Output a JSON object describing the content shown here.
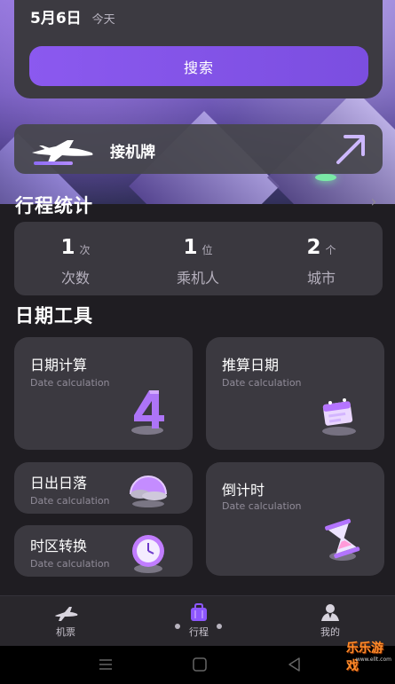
{
  "hero": {
    "date": "5月6日",
    "date_sub": "今天",
    "search_label": "搜索"
  },
  "pickup": {
    "title": "接机牌",
    "plane_icon": "airplane-icon",
    "arrow_icon": "arrow-up-right-icon"
  },
  "stats": {
    "title": "行程统计",
    "items": [
      {
        "value": "1",
        "unit": "次",
        "label": "次数"
      },
      {
        "value": "1",
        "unit": "位",
        "label": "乘机人"
      },
      {
        "value": "2",
        "unit": "个",
        "label": "城市"
      }
    ]
  },
  "tools_section": {
    "title": "日期工具"
  },
  "tools": [
    {
      "title": "日期计算",
      "subtitle": "Date calculation",
      "icon": "number-four-icon"
    },
    {
      "title": "推算日期",
      "subtitle": "Date calculation",
      "icon": "calendar-icon"
    },
    {
      "title": "日出日落",
      "subtitle": "Date calculation",
      "icon": "sunrise-icon"
    },
    {
      "title": "倒计时",
      "subtitle": "Date calculation",
      "icon": "hourglass-icon"
    },
    {
      "title": "时区转换",
      "subtitle": "Date calculation",
      "icon": "clock-icon"
    }
  ],
  "nav": {
    "items": [
      {
        "label": "机票",
        "icon": "airplane-icon"
      },
      {
        "label": "行程",
        "icon": "suitcase-icon"
      },
      {
        "label": "我的",
        "icon": "profile-icon"
      }
    ]
  },
  "system": {
    "watermark": "乐乐游戏",
    "watermark_url": "www.ellt.com"
  },
  "colors": {
    "accent": "#8b59ef",
    "background": "#1f1d22",
    "card": "#3b3940"
  }
}
